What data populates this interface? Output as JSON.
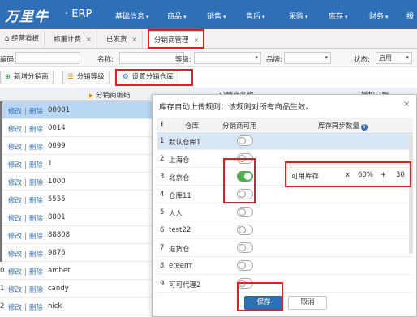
{
  "header": {
    "logo": "万里牛",
    "app": "· ERP",
    "nav": [
      {
        "label": "基础信息",
        "caret": "▾"
      },
      {
        "label": "商品",
        "caret": "▾"
      },
      {
        "label": "销售",
        "caret": "▾"
      },
      {
        "label": "售后",
        "caret": "▾"
      },
      {
        "label": "采购",
        "caret": "▾"
      },
      {
        "label": "库存",
        "caret": "▾"
      },
      {
        "label": "财务",
        "caret": "▾"
      },
      {
        "label": "报",
        "caret": ""
      }
    ]
  },
  "tabs": [
    {
      "icon": "⌂",
      "label": "经营看板",
      "close": ""
    },
    {
      "icon": "",
      "label": "称重计费",
      "close": "×"
    },
    {
      "icon": "",
      "label": "已发货",
      "close": "×"
    },
    {
      "icon": "",
      "label": "分销商管理",
      "close": "×"
    }
  ],
  "filters": {
    "code_label": "编码:",
    "name_label": "名称:",
    "level_label": "等级:",
    "brand_label": "品牌:",
    "status_label": "状态:",
    "status_value": "启用",
    "dropdown_caret": "▾"
  },
  "actions": {
    "add_icon": "⊕",
    "add": "新增分销商",
    "level_icon": "☰",
    "level": "分销等级",
    "warehouse_icon": "⚙",
    "warehouse": "设置分销仓库"
  },
  "table": {
    "col_code": "分销商编码",
    "col_name": "分销商名称",
    "col_remark": "授权日期",
    "edit": "修改",
    "sep": "|",
    "delete": "删除",
    "rows": [
      {
        "prefix": "",
        "code": "00001"
      },
      {
        "prefix": "",
        "code": "0014"
      },
      {
        "prefix": "",
        "code": "0099"
      },
      {
        "prefix": "",
        "code": "1"
      },
      {
        "prefix": "",
        "code": "1000"
      },
      {
        "prefix": "",
        "code": "5555"
      },
      {
        "prefix": "",
        "code": "8801"
      },
      {
        "prefix": "",
        "code": "88808"
      },
      {
        "prefix": "",
        "code": "9876"
      },
      {
        "prefix": "0",
        "code": "amber"
      },
      {
        "prefix": "1",
        "code": "candy"
      },
      {
        "prefix": "2",
        "code": "nick"
      }
    ]
  },
  "modal": {
    "title": "库存自动上传规则：该规则对所有商品生效。",
    "close": "×",
    "col_drag": "⁝",
    "col_warehouse": "仓库",
    "col_enabled": "分销商可用",
    "col_qty": "库存同步数量",
    "info_icon": "i",
    "rows": [
      {
        "idx": "1",
        "name": "默认仓库1",
        "on": false
      },
      {
        "idx": "2",
        "name": "上海仓",
        "on": false
      },
      {
        "idx": "3",
        "name": "北京仓",
        "on": true
      },
      {
        "idx": "4",
        "name": "仓库11",
        "on": false
      },
      {
        "idx": "5",
        "name": "人人",
        "on": false
      },
      {
        "idx": "6",
        "name": "test22",
        "on": false
      },
      {
        "idx": "7",
        "name": "退货仓",
        "on": false
      },
      {
        "idx": "8",
        "name": "ereerrr",
        "on": false
      },
      {
        "idx": "9",
        "name": "可可代理2",
        "on": false
      }
    ],
    "formula": {
      "base": "可用库存",
      "mult": "x",
      "pct": "60%",
      "plus": "+",
      "add": "30"
    },
    "save": "保存",
    "cancel": "取消"
  },
  "colors": {
    "header_bg": "#2f6fb8",
    "highlight": "#e02020",
    "toggle_on": "#4caf50",
    "selected_row": "#b9d6f2"
  }
}
